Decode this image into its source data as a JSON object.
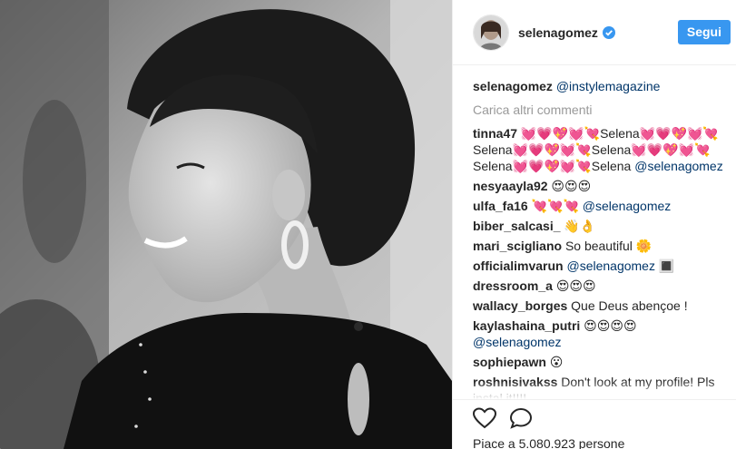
{
  "post": {
    "username": "selenagomez",
    "follow_label": "Segui",
    "caption_user": "selenagomez",
    "caption_text": "@instylemagazine",
    "load_more": "Carica altri commenti"
  },
  "comments": [
    {
      "user": "tinna47",
      "text": "💓💗💖💓💘Selena💓💗💖💓💘Selena💓💗💖💓💘Selena💓💗💖💓💘Selena💓💗💖💓💘Selena",
      "mention": "@selenagomez"
    },
    {
      "user": "nesyaayla92",
      "text": "😍😍😍",
      "mention": ""
    },
    {
      "user": "ulfa_fa16",
      "text": "💘💘💘",
      "mention": "@selenagomez"
    },
    {
      "user": "biber_salcasi_",
      "text": "👋👌",
      "mention": ""
    },
    {
      "user": "mari_scigliano",
      "text": "So beautiful 🌼",
      "mention": ""
    },
    {
      "user": "officialimvarun",
      "text": "",
      "mention": "@selenagomez 🔳"
    },
    {
      "user": "dressroom_a",
      "text": "😍😍😍",
      "mention": ""
    },
    {
      "user": "wallacy_borges",
      "text": "Que Deus abençoe !",
      "mention": ""
    },
    {
      "user": "kaylashaina_putri",
      "text": "😍😍😍😍",
      "mention": "@selenagomez"
    },
    {
      "user": "sophiepawn",
      "text": "😮",
      "mention": ""
    },
    {
      "user": "roshnisivakss",
      "text": "Don't look at my profile! Pls instal it!!!!",
      "mention": ""
    }
  ],
  "likes_text": "Piace a 5.080.923 persone",
  "colors": {
    "accent": "#3897f0",
    "mention": "#003569",
    "muted": "#999999"
  }
}
